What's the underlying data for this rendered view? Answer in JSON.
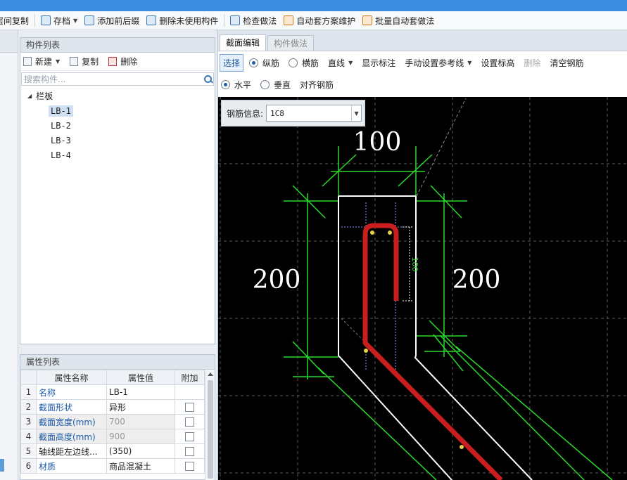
{
  "toolbar": {
    "items": [
      {
        "label": "层间复制",
        "icon": "layer-copy-icon"
      },
      {
        "label": "存档",
        "icon": "save-icon",
        "dropdown": true
      },
      {
        "label": "添加前后缀",
        "icon": "prefix-suffix-icon"
      },
      {
        "label": "删除未使用构件",
        "icon": "delete-unused-icon"
      },
      {
        "label": "检查做法",
        "icon": "check-method-icon"
      },
      {
        "label": "自动套方案维护",
        "icon": "auto-scheme-icon"
      },
      {
        "label": "批量自动套做法",
        "icon": "batch-auto-icon"
      }
    ]
  },
  "component_list": {
    "title": "构件列表",
    "new_label": "新建",
    "copy_label": "复制",
    "delete_label": "删除",
    "search_placeholder": "搜索构件...",
    "tree": {
      "root": "栏板",
      "items": [
        "LB-1",
        "LB-2",
        "LB-3",
        "LB-4"
      ],
      "selected": "LB-1"
    }
  },
  "property_list": {
    "title": "属性列表",
    "headers": [
      "属性名称",
      "属性值",
      "附加"
    ],
    "rows": [
      {
        "no": "1",
        "name": "名称",
        "value": "LB-1"
      },
      {
        "no": "2",
        "name": "截面形状",
        "value": "异形"
      },
      {
        "no": "3",
        "name": "截面宽度(mm)",
        "value": "700"
      },
      {
        "no": "4",
        "name": "截面高度(mm)",
        "value": "900"
      },
      {
        "no": "5",
        "name": "轴线距左边线...",
        "value": "(350)"
      },
      {
        "no": "6",
        "name": "材质",
        "value": "商品混凝土"
      }
    ]
  },
  "editor": {
    "tabs": [
      "截面编辑",
      "构件做法"
    ],
    "active_tab": "截面编辑",
    "tools": {
      "select": "选择",
      "longitudinal": "纵筋",
      "transverse": "横筋",
      "line": "直线",
      "show_marks": "显示标注",
      "manual_ref": "手动设置参考线",
      "set_elevation": "设置标高",
      "delete": "删除",
      "clear_rebar": "清空钢筋"
    },
    "tools2": {
      "horizontal": "水平",
      "vertical": "垂直",
      "align_rebar": "对齐钢筋"
    },
    "rebar_info_label": "钢筋信息:",
    "rebar_info_value": "1C8",
    "dimensions": {
      "top": "100",
      "left": "200",
      "right": "200",
      "inner": "100"
    },
    "colors": {
      "canvas": "#000000",
      "outline": "#ffffff",
      "dimension": "#2bd92b",
      "rebar": "#c81e1e",
      "grid": "#5a5a5a"
    }
  }
}
